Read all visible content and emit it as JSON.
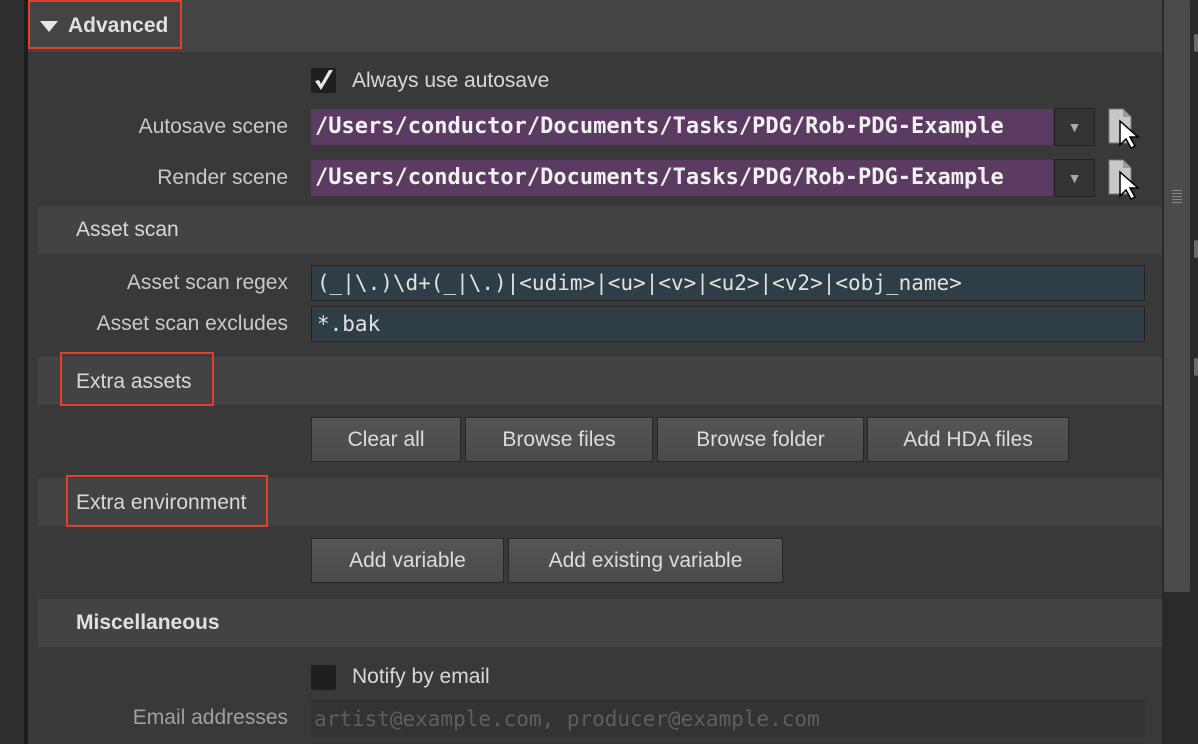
{
  "advanced": {
    "label": "Advanced"
  },
  "autosave": {
    "always_label": "Always use autosave",
    "always_checked": true,
    "autosave_label": "Autosave scene",
    "autosave_value": "/Users/conductor/Documents/Tasks/PDG/Rob-PDG-Example",
    "render_label": "Render scene",
    "render_value": "/Users/conductor/Documents/Tasks/PDG/Rob-PDG-Example",
    "dropdown_glyph": "▼"
  },
  "asset_scan": {
    "title": "Asset scan",
    "regex_label": "Asset scan regex",
    "regex_value": "(_|\\.)\\d+(_|\\.)|<udim>|<u>|<v>|<u2>|<v2>|<obj_name>",
    "excludes_label": "Asset scan excludes",
    "excludes_value": "*.bak"
  },
  "extra_assets": {
    "title": "Extra assets",
    "buttons": [
      "Clear all",
      "Browse files",
      "Browse folder",
      "Add HDA files"
    ]
  },
  "extra_env": {
    "title": "Extra environment",
    "buttons": [
      "Add variable",
      "Add existing variable"
    ]
  },
  "misc": {
    "title": "Miscellaneous",
    "notify_label": "Notify by email",
    "notify_checked": false,
    "email_label": "Email addresses",
    "email_placeholder": "artist@example.com, producer@example.com"
  },
  "colors": {
    "highlight": "#e1402a",
    "path_field": "#5c3b62",
    "text_field": "#2f3e46"
  },
  "icons": {
    "collapse": "triangle-down-icon",
    "checkmark": "checkmark-icon",
    "file_chooser": "file-chooser-icon"
  }
}
